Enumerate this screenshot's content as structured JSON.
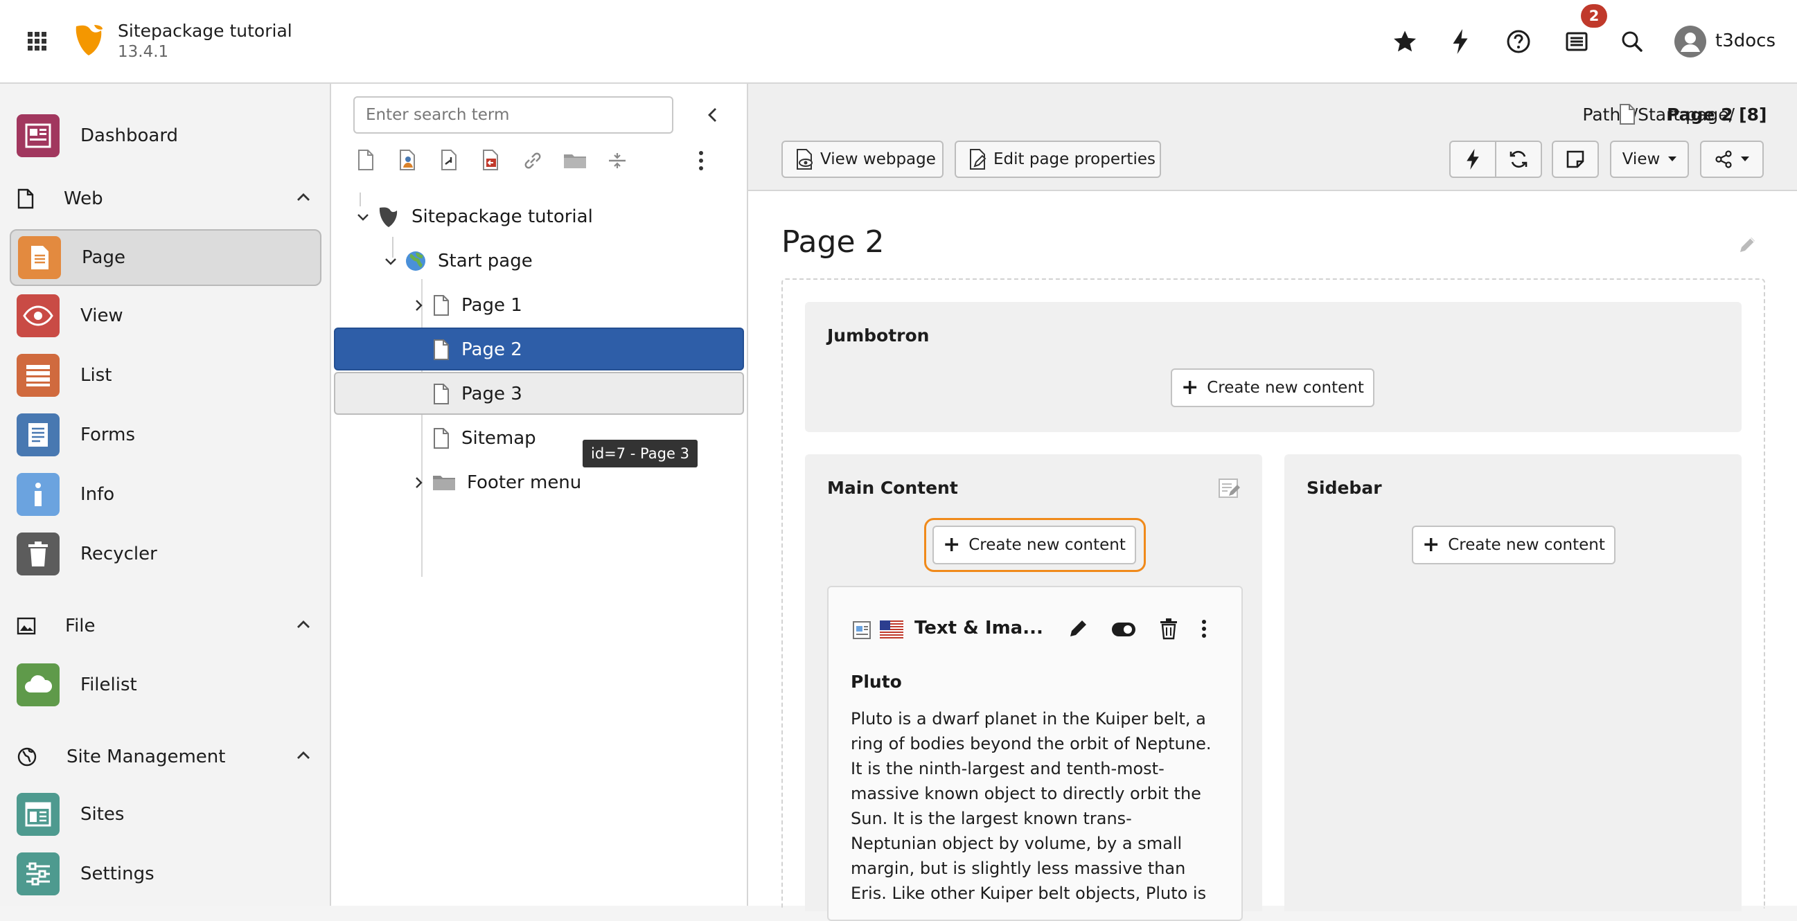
{
  "topbar": {
    "site_name": "Sitepackage tutorial",
    "version": "13.4.1",
    "notification_count": "2",
    "username": "t3docs",
    "icons": [
      "grid-icon",
      "typo3-logo",
      "star-icon",
      "flash-icon",
      "help-icon",
      "list-icon",
      "search-icon",
      "user-avatar-icon"
    ]
  },
  "modules": {
    "dashboard": "Dashboard",
    "web_group": "Web",
    "page": "Page",
    "view": "View",
    "list": "List",
    "forms": "Forms",
    "info": "Info",
    "recycler": "Recycler",
    "file_group": "File",
    "filelist": "Filelist",
    "site_group": "Site Management",
    "sites": "Sites",
    "settings": "Settings"
  },
  "tree": {
    "search_placeholder": "Enter search term",
    "root": "Sitepackage tutorial",
    "start": "Start page",
    "page1": "Page 1",
    "page2": "Page 2",
    "page3": "Page 3",
    "sitemap": "Sitemap",
    "footer": "Footer menu",
    "tooltip": "id=7 - Page 3"
  },
  "docheader": {
    "path_label": "Path: /Start page/",
    "path_current": "Page 2 [8]",
    "view_webpage": "View webpage",
    "edit_props": "Edit page properties",
    "view_dropdown": "View"
  },
  "page": {
    "title": "Page 2",
    "jumbotron": "Jumbotron",
    "main_content": "Main Content",
    "sidebar": "Sidebar",
    "create_new": "Create new content"
  },
  "content_element": {
    "type": "Text & Ima...",
    "header": "Pluto",
    "body_lines": [
      "Pluto is a dwarf planet in the Kuiper belt, a",
      "ring of bodies beyond the orbit of Neptune.",
      "It is the ninth-largest and tenth-most-",
      "massive known object to directly orbit the",
      "Sun. It is the largest known trans-",
      "Neptunian object by volume, by a small",
      "margin, but is slightly less massive than",
      "Eris. Like other Kuiper belt objects, Pluto is"
    ]
  },
  "colors": {
    "accent_orange": "#ff8700",
    "selected_blue": "#2e5ea8",
    "badge_red": "#c0392b"
  }
}
